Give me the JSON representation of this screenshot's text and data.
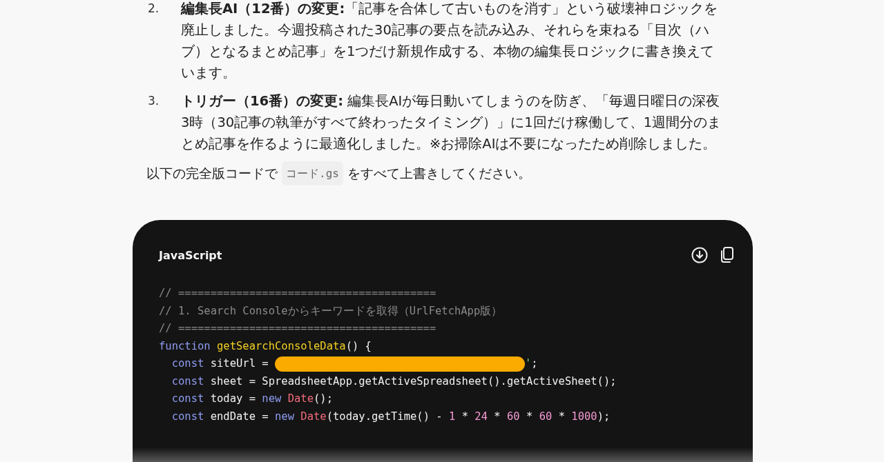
{
  "steps": [
    {
      "number": "2.",
      "text": "**編集長AI（12番）の変更:**「記事を合体して古いものを消す」という破壊神ロジックを廃止しました。今週投稿された30記事の要点を読み込み、それらを束ねる「目次（ハブ）となるまとめ記事」を1つだけ新規作成する、本物の編集長ロジックに書き換えています。"
    },
    {
      "number": "3.",
      "text": "**トリガー（16番）の変更:** 編集長AIが毎日動いてしまうのを防ぎ、「毎週日曜日の深夜3時（30記事の執筆がすべて終わったタイミング）」に1回だけ稼働して、1週間分のまとめ記事を作るように最適化しました。※お掃除AIは不要になったため削除しました。"
    }
  ],
  "instruction": {
    "before": "以下の完全版コードで",
    "code": "コード.gs",
    "after": "をすべて上書きしてください。"
  },
  "code_block": {
    "language": "JavaScript",
    "lines": [
      [
        {
          "kind": "comment",
          "text": "// ========================================"
        }
      ],
      [
        {
          "kind": "comment",
          "text": "// 1. Search Consoleからキーワードを取得（UrlFetchApp版）"
        }
      ],
      [
        {
          "kind": "comment",
          "text": "// ========================================"
        }
      ],
      [
        {
          "kind": "keyword",
          "text": "function"
        },
        {
          "kind": "func",
          "text": " getSearchConsoleData"
        },
        {
          "kind": "plain",
          "text": "() {"
        }
      ],
      [
        {
          "kind": "keyword",
          "text": "  const"
        },
        {
          "kind": "plain",
          "text": " siteUrl = "
        },
        {
          "kind": "redacted"
        },
        {
          "kind": "string",
          "text": "'"
        },
        {
          "kind": "plain",
          "text": ";"
        }
      ],
      [
        {
          "kind": "keyword",
          "text": "  const"
        },
        {
          "kind": "plain",
          "text": " sheet = SpreadsheetApp.getActiveSpreadsheet().getActiveSheet();"
        }
      ],
      [
        {
          "kind": "keyword",
          "text": "  const"
        },
        {
          "kind": "plain",
          "text": " today = "
        },
        {
          "kind": "keyword",
          "text": "new"
        },
        {
          "kind": "class",
          "text": " Date"
        },
        {
          "kind": "plain",
          "text": "();"
        }
      ],
      [
        {
          "kind": "keyword",
          "text": "  const"
        },
        {
          "kind": "plain",
          "text": " endDate = "
        },
        {
          "kind": "keyword",
          "text": "new"
        },
        {
          "kind": "class",
          "text": " Date"
        },
        {
          "kind": "plain",
          "text": "(today.getTime() - "
        },
        {
          "kind": "number",
          "text": "1"
        },
        {
          "kind": "plain",
          "text": " * "
        },
        {
          "kind": "number",
          "text": "24"
        },
        {
          "kind": "plain",
          "text": " * "
        },
        {
          "kind": "number",
          "text": "60"
        },
        {
          "kind": "plain",
          "text": " * "
        },
        {
          "kind": "number",
          "text": "60"
        },
        {
          "kind": "plain",
          "text": " * "
        },
        {
          "kind": "number",
          "text": "1000"
        },
        {
          "kind": "plain",
          "text": ");"
        }
      ]
    ]
  }
}
